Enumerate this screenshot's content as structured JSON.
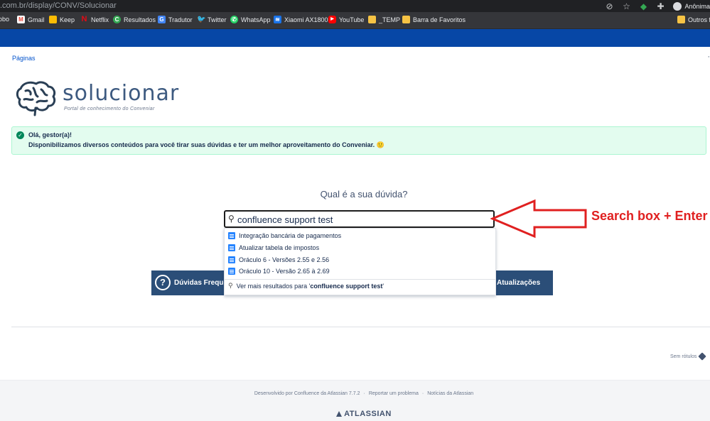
{
  "browser": {
    "url": ".com.br/display/CONV/Solucionar",
    "profile_label": "Anônima",
    "bookmarks": [
      {
        "label": "obo",
        "icon": "",
        "color": ""
      },
      {
        "label": "Gmail",
        "icon": "gmail-icon",
        "color": "#ea4335"
      },
      {
        "label": "Keep",
        "icon": "keep-icon",
        "color": "#fbbc04"
      },
      {
        "label": "Netflix",
        "icon": "netflix-icon",
        "color": "#e50914"
      },
      {
        "label": "Resultados",
        "icon": "resultados-icon",
        "color": "#34a853"
      },
      {
        "label": "Tradutor",
        "icon": "translate-icon",
        "color": "#4285f4"
      },
      {
        "label": "Twitter",
        "icon": "twitter-icon",
        "color": "#1da1f2"
      },
      {
        "label": "WhatsApp",
        "icon": "whatsapp-icon",
        "color": "#25d366"
      },
      {
        "label": "Xiaomi AX1800",
        "icon": "wifi-icon",
        "color": "#1a73e8"
      },
      {
        "label": "YouTube",
        "icon": "youtube-icon",
        "color": "#ff0000"
      },
      {
        "label": "_TEMP",
        "icon": "folder-icon",
        "color": "#f6c344"
      },
      {
        "label": "Barra de Favoritos",
        "icon": "folder-icon",
        "color": "#f6c344"
      },
      {
        "label": "Outros fa",
        "icon": "folder-icon",
        "color": "#f6c344"
      }
    ]
  },
  "page": {
    "breadcrumb": "Páginas",
    "logo_title": "solucionar",
    "logo_subtitle": "Portal de conhecimento do Conveniar",
    "alert_title": "Olá, gestor(a)!",
    "alert_text": "Disponibilizamos diversos conteúdos para você tirar suas dúvidas e ter um melhor aproveitamento do Conveniar. 🙂",
    "question": "Qual é a sua dúvida?",
    "search_value": "confluence support test",
    "suggestions": [
      "Integração bancária de pagamentos",
      "Atualizar tabela de impostos",
      "Oráculo 6 - Versões 2.55 e 2.56",
      "Oráculo 10 - Versão 2.65 à 2.69"
    ],
    "more_results_prefix": "Ver mais resultados para '",
    "more_results_query": "confluence support test",
    "more_results_suffix": "'",
    "button_left": "Dúvidas Frequentes",
    "button_right": "Atualizações",
    "labels_text": "Sem rótulos"
  },
  "annotation": {
    "label": "Search box + Enter",
    "color": "#e02020"
  },
  "footer": {
    "developed_by": "Desenvolvido por Confluence da Atlassian 7.7.2",
    "report": "Reportar um problema",
    "news": "Notícias da Atlassian",
    "brand": "ATLASSIAN"
  },
  "colors": {
    "brand_blue": "#0747a6",
    "link": "#0052cc",
    "button_bg": "#2b4e78",
    "success_bg": "#e3fcef"
  }
}
